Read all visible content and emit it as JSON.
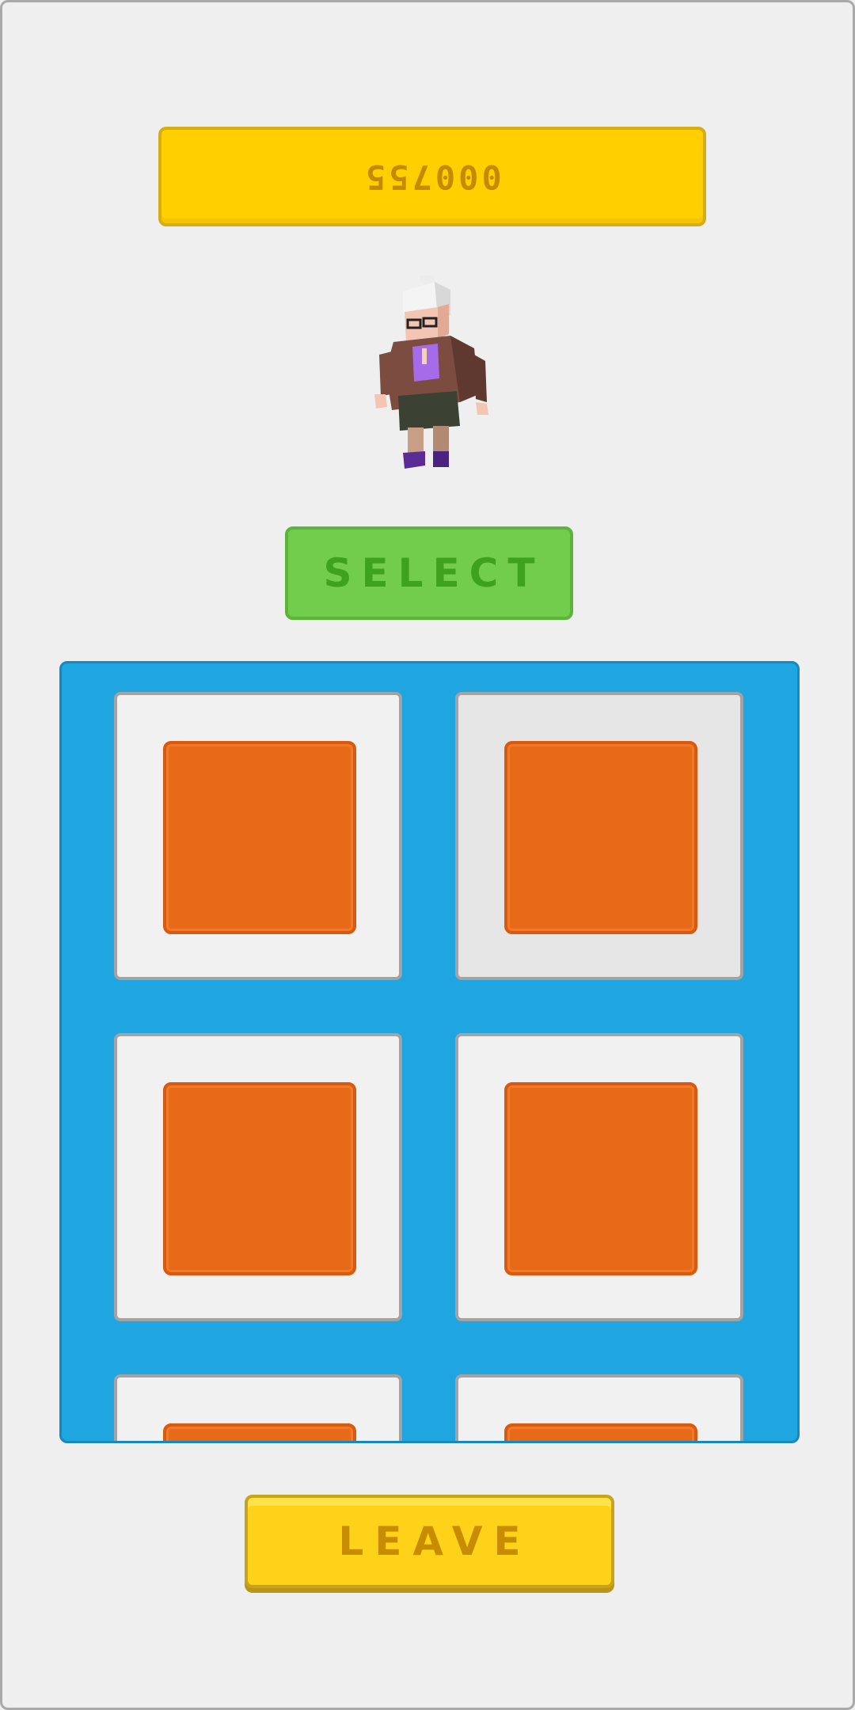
{
  "coins": {
    "value": "000755"
  },
  "character": {
    "icon": "elderly-grandma-character"
  },
  "buttons": {
    "select_label": "SELECT",
    "leave_label": "LEAVE"
  },
  "grid": {
    "tiles": [
      {
        "icon": "orange-block-icon",
        "color": "#e86917",
        "selected": false
      },
      {
        "icon": "orange-block-icon",
        "color": "#e86917",
        "selected": true
      },
      {
        "icon": "orange-block-icon",
        "color": "#e86917",
        "selected": false
      },
      {
        "icon": "orange-block-icon",
        "color": "#e86917",
        "selected": false
      },
      {
        "icon": "orange-block-icon",
        "color": "#e86917",
        "selected": false
      },
      {
        "icon": "orange-block-icon",
        "color": "#e86917",
        "selected": false
      }
    ]
  },
  "colors": {
    "background": "#efefef",
    "coins_bg": "#ffcf00",
    "select_bg": "#72cd4d",
    "grid_bg": "#1fa6e0",
    "leave_bg": "#ffd21a",
    "tile_item": "#e86917"
  }
}
